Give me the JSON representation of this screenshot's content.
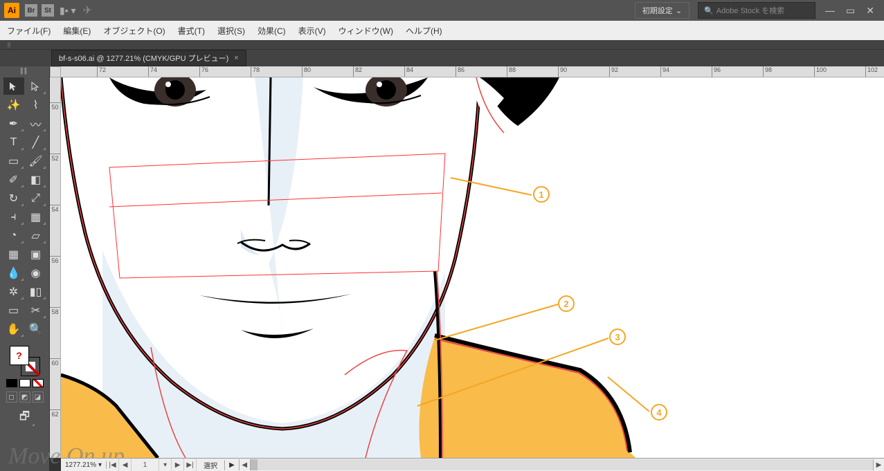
{
  "app": {
    "logo": "Ai",
    "bridge": "Br",
    "stock": "St"
  },
  "workspace": {
    "label": "初期設定"
  },
  "search": {
    "placeholder": "Adobe Stock を検索"
  },
  "menu": {
    "file": "ファイル(F)",
    "edit": "編集(E)",
    "object": "オブジェクト(O)",
    "type": "書式(T)",
    "select": "選択(S)",
    "effect": "効果(C)",
    "view": "表示(V)",
    "window": "ウィンドウ(W)",
    "help": "ヘルプ(H)"
  },
  "tab": {
    "label": "bf-s-s06.ai @ 1277.21% (CMYK/GPU プレビュー)",
    "close": "×"
  },
  "ruler_h": {
    "ticks": [
      {
        "pos": 52,
        "label": "72"
      },
      {
        "pos": 126,
        "label": "74"
      },
      {
        "pos": 200,
        "label": "76"
      },
      {
        "pos": 274,
        "label": "78"
      },
      {
        "pos": 348,
        "label": "80"
      },
      {
        "pos": 422,
        "label": "82"
      },
      {
        "pos": 496,
        "label": "84"
      },
      {
        "pos": 570,
        "label": "86"
      },
      {
        "pos": 644,
        "label": "88"
      },
      {
        "pos": 718,
        "label": "90"
      },
      {
        "pos": 792,
        "label": "92"
      },
      {
        "pos": 866,
        "label": "94"
      },
      {
        "pos": 940,
        "label": "96"
      },
      {
        "pos": 1014,
        "label": "98"
      },
      {
        "pos": 1088,
        "label": "100"
      },
      {
        "pos": 1162,
        "label": "102"
      }
    ]
  },
  "ruler_v": {
    "ticks": [
      {
        "pos": 36,
        "label": "50"
      },
      {
        "pos": 110,
        "label": "52"
      },
      {
        "pos": 184,
        "label": "54"
      },
      {
        "pos": 258,
        "label": "56"
      },
      {
        "pos": 332,
        "label": "58"
      },
      {
        "pos": 406,
        "label": "60"
      },
      {
        "pos": 480,
        "label": "62"
      }
    ]
  },
  "status": {
    "zoom": "1277.21%",
    "artboard": "1",
    "tool": "選択"
  },
  "annotations": {
    "a1": "1",
    "a2": "2",
    "a3": "3",
    "a4": "4"
  },
  "watermark": "Move On up",
  "fill_mark": "?"
}
